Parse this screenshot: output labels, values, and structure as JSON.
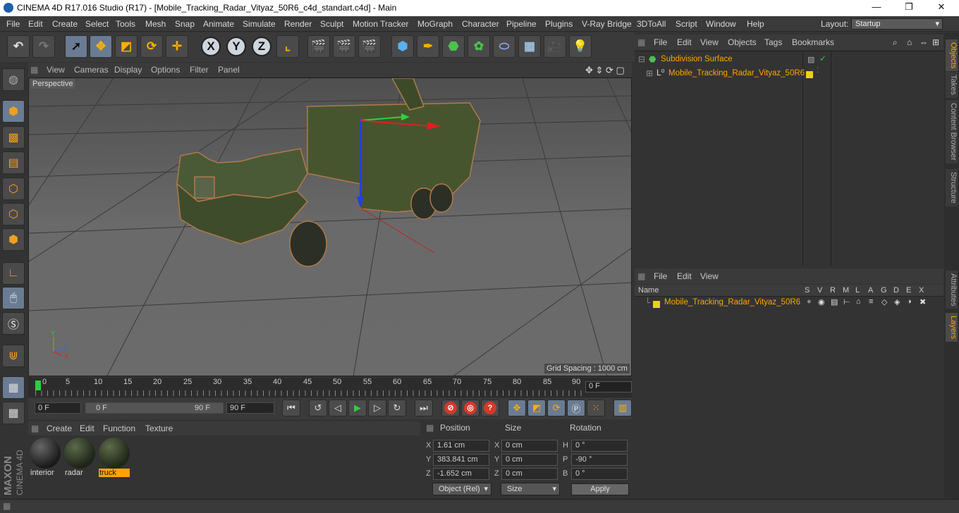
{
  "window": {
    "title": "CINEMA 4D R17.016 Studio (R17) - [Mobile_Tracking_Radar_Vityaz_50R6_c4d_standart.c4d] - Main",
    "min": "—",
    "max": "❐",
    "close": "✕"
  },
  "menubar": {
    "items": [
      "File",
      "Edit",
      "Create",
      "Select",
      "Tools",
      "Mesh",
      "Snap",
      "Animate",
      "Simulate",
      "Render",
      "Sculpt",
      "Motion Tracker",
      "MoGraph",
      "Character",
      "Pipeline",
      "Plugins",
      "V-Ray Bridge",
      "3DToAll",
      "Script",
      "Window",
      "Help"
    ],
    "layout_label": "Layout:",
    "layout_value": "Startup"
  },
  "toolbar": {
    "x": "X",
    "y": "Y",
    "z": "Z"
  },
  "viewport": {
    "menu": [
      "View",
      "Cameras",
      "Display",
      "Options",
      "Filter",
      "Panel"
    ],
    "label": "Perspective",
    "grid_spacing": "Grid Spacing : 1000 cm"
  },
  "timeline": {
    "ticks": [
      "0",
      "5",
      "10",
      "15",
      "20",
      "25",
      "30",
      "35",
      "40",
      "45",
      "50",
      "55",
      "60",
      "65",
      "70",
      "75",
      "80",
      "85",
      "90"
    ],
    "current_frame": "0 F"
  },
  "transport": {
    "start": "0 F",
    "range_start": "0 F",
    "range_end": "90 F",
    "end": "90 F"
  },
  "materials": {
    "menu": [
      "Create",
      "Edit",
      "Function",
      "Texture"
    ],
    "items": [
      {
        "name": "interior"
      },
      {
        "name": "radar"
      },
      {
        "name": "truck"
      }
    ]
  },
  "coordinates": {
    "headers": [
      "Position",
      "Size",
      "Rotation"
    ],
    "rows": [
      {
        "axis": "X",
        "pos": "1.61 cm",
        "size_axis": "X",
        "size": "0 cm",
        "rot_axis": "H",
        "rot": "0 °"
      },
      {
        "axis": "Y",
        "pos": "383.841 cm",
        "size_axis": "Y",
        "size": "0 cm",
        "rot_axis": "P",
        "rot": "-90 °"
      },
      {
        "axis": "Z",
        "pos": "-1.652 cm",
        "size_axis": "Z",
        "size": "0 cm",
        "rot_axis": "B",
        "rot": "0 °"
      }
    ],
    "mode": "Object (Rel)",
    "size_mode": "Size",
    "apply": "Apply"
  },
  "objects": {
    "menu": [
      "File",
      "Edit",
      "View",
      "Objects",
      "Tags",
      "Bookmarks"
    ],
    "items": [
      {
        "name": "Subdivision Surface"
      },
      {
        "name": "Mobile_Tracking_Radar_Vityaz_50R6"
      }
    ]
  },
  "layers": {
    "menu": [
      "File",
      "Edit",
      "View"
    ],
    "columns": [
      "Name",
      "S",
      "V",
      "R",
      "M",
      "L",
      "A",
      "G",
      "D",
      "E",
      "X"
    ],
    "items": [
      {
        "name": "Mobile_Tracking_Radar_Vityaz_50R6"
      }
    ]
  },
  "sidetabs": [
    "Objects",
    "Takes",
    "Content Browser",
    "Structure",
    "Attributes",
    "Layers"
  ],
  "logo": {
    "line1": "MAXON",
    "line2": "CINEMA 4D"
  }
}
